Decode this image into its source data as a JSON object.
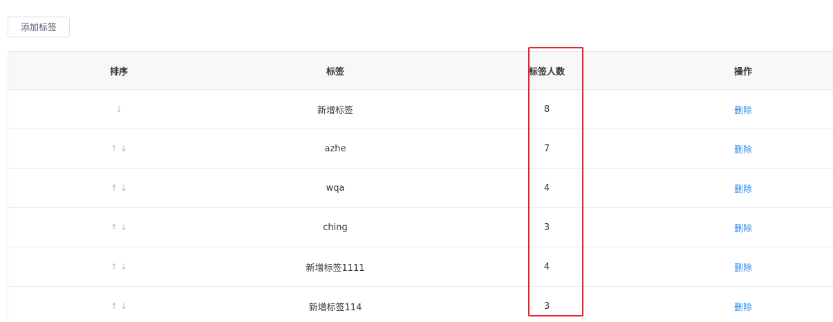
{
  "toolbar": {
    "add_label": "添加标签"
  },
  "table": {
    "headers": {
      "sort": "排序",
      "label": "标签",
      "count": "标签人数",
      "action": "操作"
    },
    "up_arrow": "↑",
    "down_arrow": "↓",
    "rows": [
      {
        "name": "新增标签",
        "count": "8",
        "action": "删除",
        "has_up": false,
        "has_down": true
      },
      {
        "name": "azhe",
        "count": "7",
        "action": "删除",
        "has_up": true,
        "has_down": true
      },
      {
        "name": "wqa",
        "count": "4",
        "action": "删除",
        "has_up": true,
        "has_down": true
      },
      {
        "name": "ching",
        "count": "3",
        "action": "删除",
        "has_up": true,
        "has_down": true
      },
      {
        "name": "新增标签1111",
        "count": "4",
        "action": "删除",
        "has_up": true,
        "has_down": true
      },
      {
        "name": "新增标签114",
        "count": "3",
        "action": "删除",
        "has_up": true,
        "has_down": true
      }
    ]
  },
  "colors": {
    "link": "#2d8cf0",
    "highlight_border": "#e8222b",
    "header_bg": "#f8f8f9",
    "border": "#e8eaec"
  }
}
